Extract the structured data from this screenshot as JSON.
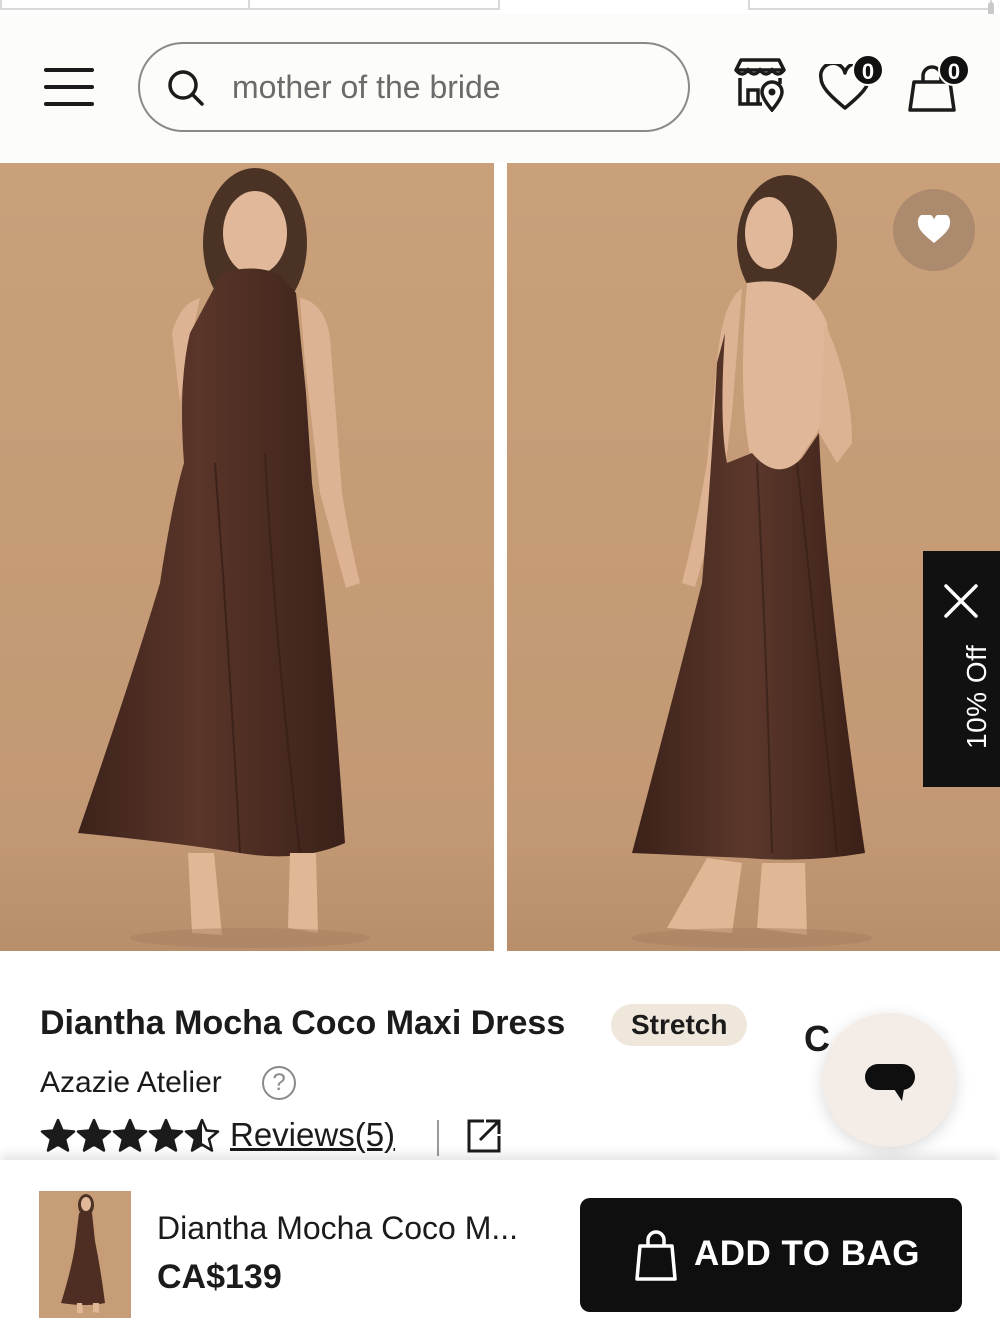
{
  "search": {
    "query": "mother of the bride"
  },
  "header": {
    "wishlist_count": "0",
    "cart_count": "0"
  },
  "promo": {
    "label": "10% Off"
  },
  "product": {
    "title": "Diantha Mocha Coco Maxi Dress",
    "tag": "Stretch",
    "price_peek": "C       9",
    "brand": "Azazie Atelier",
    "help_symbol": "?",
    "rating": 4.5,
    "rating_max": 5,
    "reviews_label": "Reviews(5)"
  },
  "sticky_bar": {
    "name": "Diantha Mocha Coco M...",
    "price": "CA$139",
    "add_label": "ADD TO BAG"
  },
  "colors": {
    "dress": "#4a2b22",
    "backdrop": "#c8a07c",
    "accent_dark": "#0f0f0f",
    "tag_bg": "#efe6dc"
  }
}
